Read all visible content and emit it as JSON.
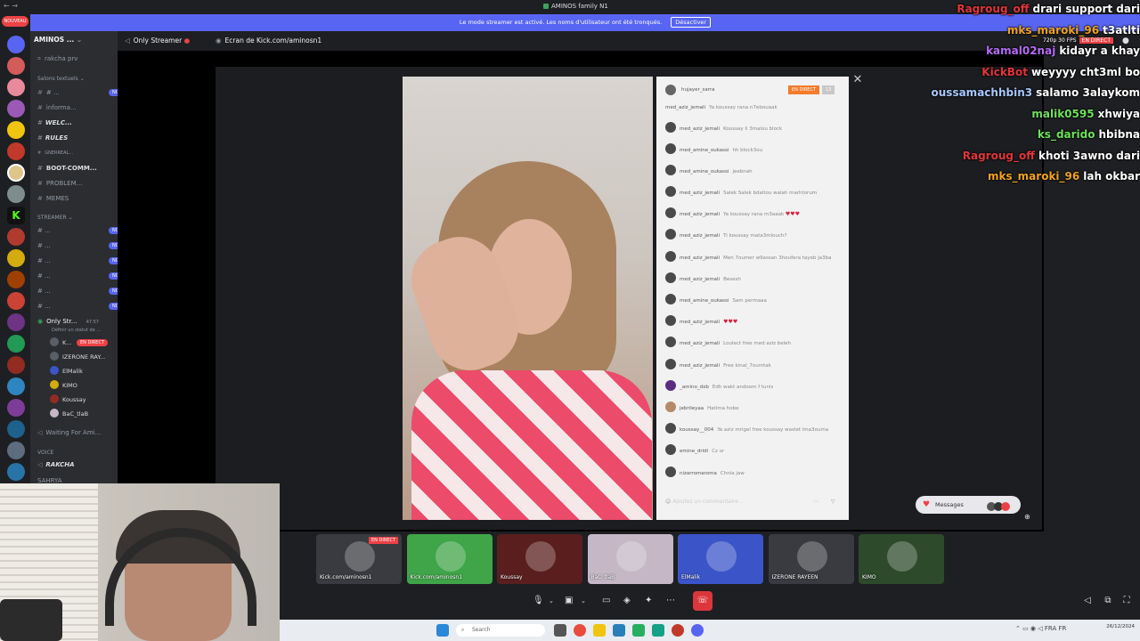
{
  "titlebar": {
    "title": "AMINOS family N1",
    "nav": "← →"
  },
  "banner": {
    "text": "Le mode streamer est activé. Les noms d'utilisateur ont été tronqués.",
    "button": "Désactiver"
  },
  "servers": {
    "new_badge": "NOUVEAU"
  },
  "sidebar": {
    "server_name": "AMINOS ...",
    "top_item": "rakcha prv",
    "cat_text": "Salons textuels",
    "text_channels": [
      {
        "label": "# ...",
        "badge": "NOUVEAU"
      },
      {
        "label": "informa...",
        "badge": ""
      },
      {
        "label": "WELC...",
        "badge": ""
      },
      {
        "label": "RULES",
        "badge": ""
      },
      {
        "label": "GNERREAL...",
        "badge": ""
      },
      {
        "label": "BOOT-COMM...",
        "badge": ""
      },
      {
        "label": "PROBLEM...",
        "badge": ""
      },
      {
        "label": "MEMES",
        "badge": ""
      }
    ],
    "cat_streamer": "STREAMER",
    "streamer_channels": [
      {
        "label": "# ...",
        "badge": "NOUVEAU"
      },
      {
        "label": "# ...",
        "badge": "NOUVEAU"
      },
      {
        "label": "# ...",
        "badge": "NOUVEAU"
      },
      {
        "label": "# ...",
        "badge": "NOUVEAU"
      },
      {
        "label": "# ...",
        "badge": "NOUVEAU"
      },
      {
        "label": "# ...",
        "badge": "NOUVEAU"
      }
    ],
    "voice_channel": "Only Str...",
    "voice_count": "47:57",
    "voice_status": "Définir un statut de ...",
    "voice_users": [
      {
        "name": "K...",
        "tag": "EN DIRECT"
      },
      {
        "name": "IZERONE RAY...",
        "tag": ""
      },
      {
        "name": "ElMalik",
        "tag": ""
      },
      {
        "name": "KIMO",
        "tag": ""
      },
      {
        "name": "Koussay",
        "tag": ""
      },
      {
        "name": "BaC_tlaB",
        "tag": ""
      }
    ],
    "waiting": "Waiting For Ami...",
    "cat_voice": "VOICE",
    "voice_extra": "RAKCHA",
    "voice_extra2": "SAHRYA"
  },
  "channel_header": {
    "channel": "Only Streamer",
    "screen": "Ecran de Kick.com/aminosn1"
  },
  "phone_chat": {
    "host": "hujayer_sarra",
    "live": "EN DIRECT",
    "viewers": "13",
    "messages": [
      {
        "user": "med_aziz_jemali",
        "text": "Ya koussay rana n7ebouaak"
      },
      {
        "user": "med_aziz_jemali",
        "text": "Koussay li 3malou block"
      },
      {
        "user": "med_amine_oukassi",
        "text": "hh block3ou"
      },
      {
        "user": "med_amine_oukassi",
        "text": "jeebnah"
      },
      {
        "user": "med_aziz_jemali",
        "text": "Salek Salek bdaltou walah marhtorum"
      },
      {
        "user": "med_aziz_jemali",
        "text": "Ya koussay rana m3aaak",
        "hearts": "♥♥♥"
      },
      {
        "user": "med_aziz_jemali",
        "text": "Ti koussay mata3mlouch?"
      },
      {
        "user": "med_aziz_jemali",
        "text": "Men 7oumer w9assan 3houfera tayeb ja3ba"
      },
      {
        "user": "med_aziz_jemali",
        "text": "Besesh"
      },
      {
        "user": "med_amine_oukassi",
        "text": "Sam permaaa"
      },
      {
        "user": "med_aziz_jemali",
        "text": "",
        "hearts": "♥♥♥"
      },
      {
        "user": "med_aziz_jemali",
        "text": "Loulect free med aziz beleh"
      },
      {
        "user": "med_aziz_jemali",
        "text": "Free kinal_7oumtak"
      },
      {
        "user": "_amino_dxb",
        "text": "Edh wakt andoom f tunis"
      },
      {
        "user": "jebrileyaa",
        "text": "Hatima hobe"
      },
      {
        "user": "koussay__004",
        "text": "Ya aziz mrigel free koussay waslet ima3ouma"
      },
      {
        "user": "emine_dridi",
        "text": "Cz or"
      },
      {
        "user": "nizarromaroma",
        "text": "Chnia jaw"
      }
    ],
    "input_placeholder": "Ajoutez un commentaire..."
  },
  "messages_button": {
    "label": "Messages"
  },
  "kick_chat": {
    "meta": "720p 30 FPS",
    "meta_live": "EN DIRECT",
    "lines": [
      {
        "user": "Ragroug_off",
        "msg": "drari support dari",
        "color": "#e0353a"
      },
      {
        "user": "mks_maroki_96",
        "msg": "t3atlti",
        "color": "#f0a21e"
      },
      {
        "user": "kamal02naj",
        "msg": "kidayr a khay",
        "color": "#b46bf5"
      },
      {
        "user": "KickBot",
        "msg": "weyyyy cht3ml bo",
        "color": "#e0353a"
      },
      {
        "user": "oussamachhbin3",
        "msg": "salamo 3alaykom",
        "color": "#a8c8ff"
      },
      {
        "user": "malik0595",
        "msg": "xhwiya",
        "color": "#6fe05c"
      },
      {
        "user": "ks_darido",
        "msg": "hbibna",
        "color": "#6fe05c"
      },
      {
        "user": "Ragroug_off",
        "msg": "khoti 3awno dari",
        "color": "#e0353a"
      },
      {
        "user": "mks_maroki_96",
        "msg": "lah okbar",
        "color": "#f0a21e"
      }
    ]
  },
  "participants": [
    {
      "label": "Kick.com/aminosn1",
      "live": "EN DIRECT",
      "bg": "#3a3b40"
    },
    {
      "label": "Kick.com/aminosn1",
      "live": "",
      "bg": "#3fa548"
    },
    {
      "label": "Koussay",
      "live": "",
      "bg": "#5a1e1e"
    },
    {
      "label": "BaC_tlaB",
      "live": "",
      "bg": "#c5b7c6"
    },
    {
      "label": "ElMalik",
      "live": "",
      "bg": "#3b55c9"
    },
    {
      "label": "IZERONE RAYEEN",
      "live": "",
      "bg": "#3a3b40"
    },
    {
      "label": "KIMO",
      "live": "",
      "bg": "#2d4a2a"
    }
  ],
  "taskbar": {
    "search": "Search",
    "date": "26/12/2024",
    "lang": "FRA FR"
  },
  "colors": {
    "accent": "#5865f2",
    "live": "#ed4245",
    "leave": "#da373c"
  }
}
